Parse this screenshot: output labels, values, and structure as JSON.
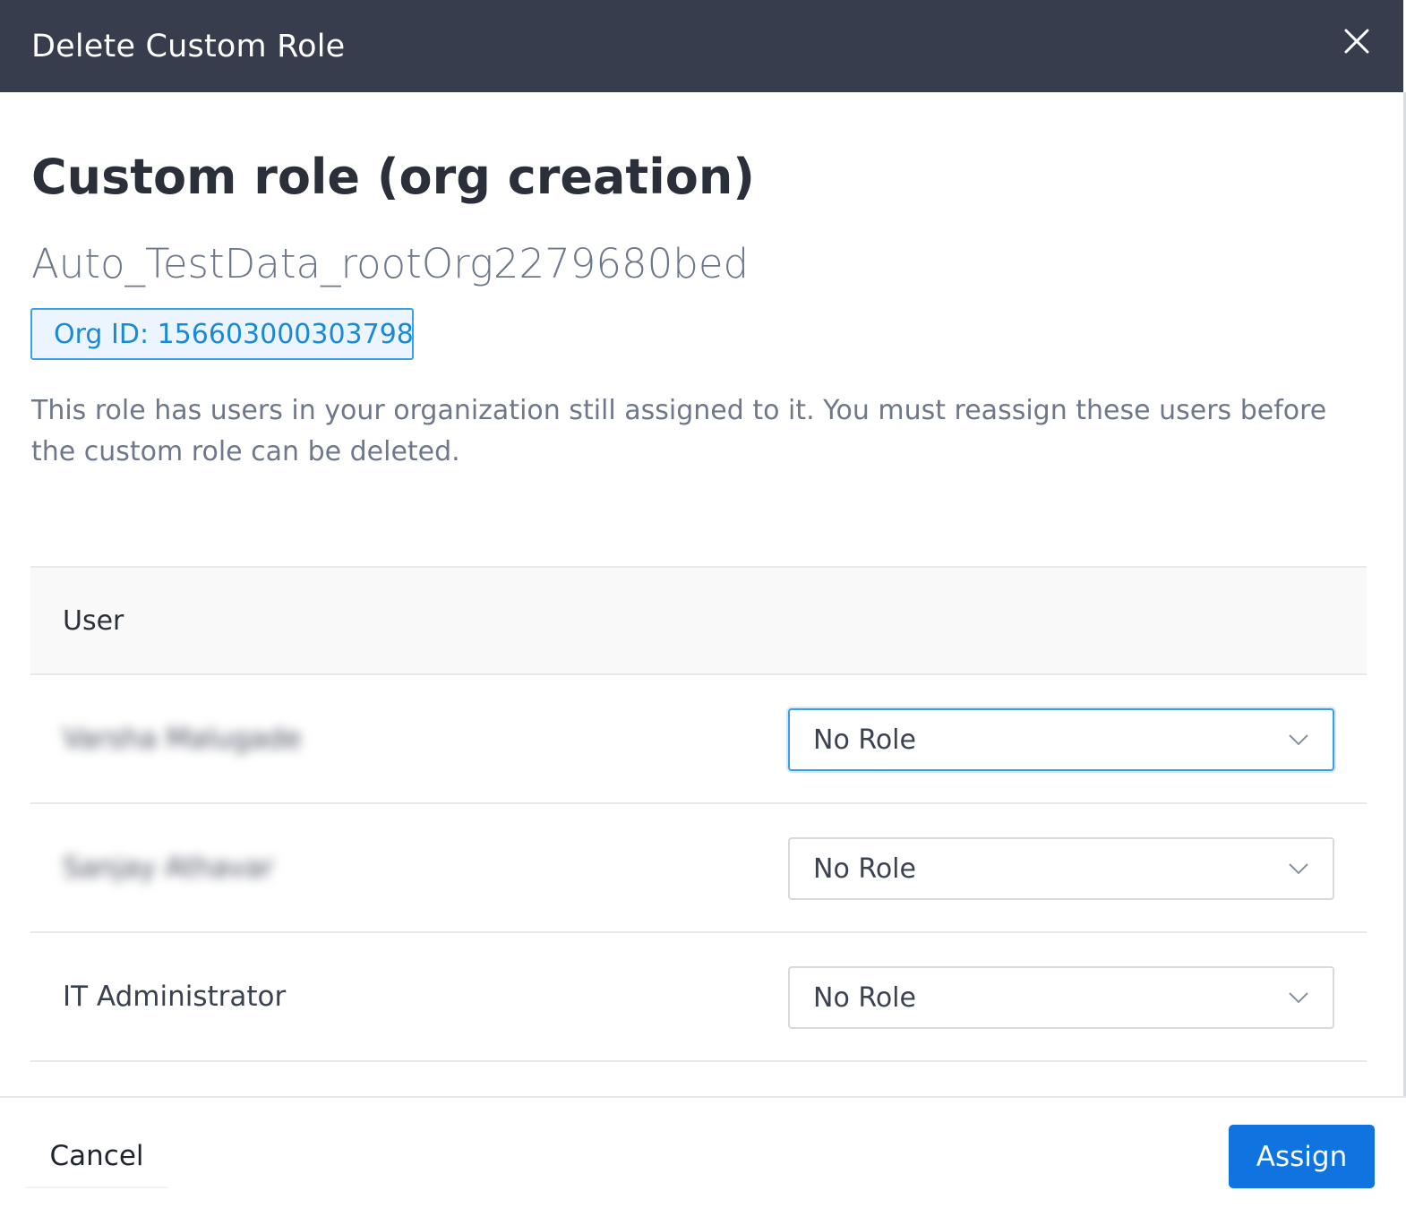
{
  "dialog": {
    "title": "Delete Custom Role",
    "role_name": "Custom role (org creation)",
    "org_name": "Auto_TestData_rootOrg2279680bed",
    "org_id": "Org ID: 156603000303798",
    "description": "This role has users in your organization still assigned to it. You must reassign these users before the custom role can be deleted."
  },
  "table": {
    "header": "User",
    "rows": [
      {
        "user": "Varsha Malugade",
        "role": "No Role"
      },
      {
        "user": "Sanjay Athavar",
        "role": "No Role"
      },
      {
        "user": "IT Administrator",
        "role": "No Role"
      }
    ]
  },
  "footer": {
    "cancel_label": "Cancel",
    "assign_label": "Assign"
  },
  "colors": {
    "header_bg": "#373d4c",
    "accent": "#0f73e0",
    "badge_border": "#3ba0e6"
  },
  "icons": [
    "close-icon",
    "chevron-down-icon"
  ]
}
